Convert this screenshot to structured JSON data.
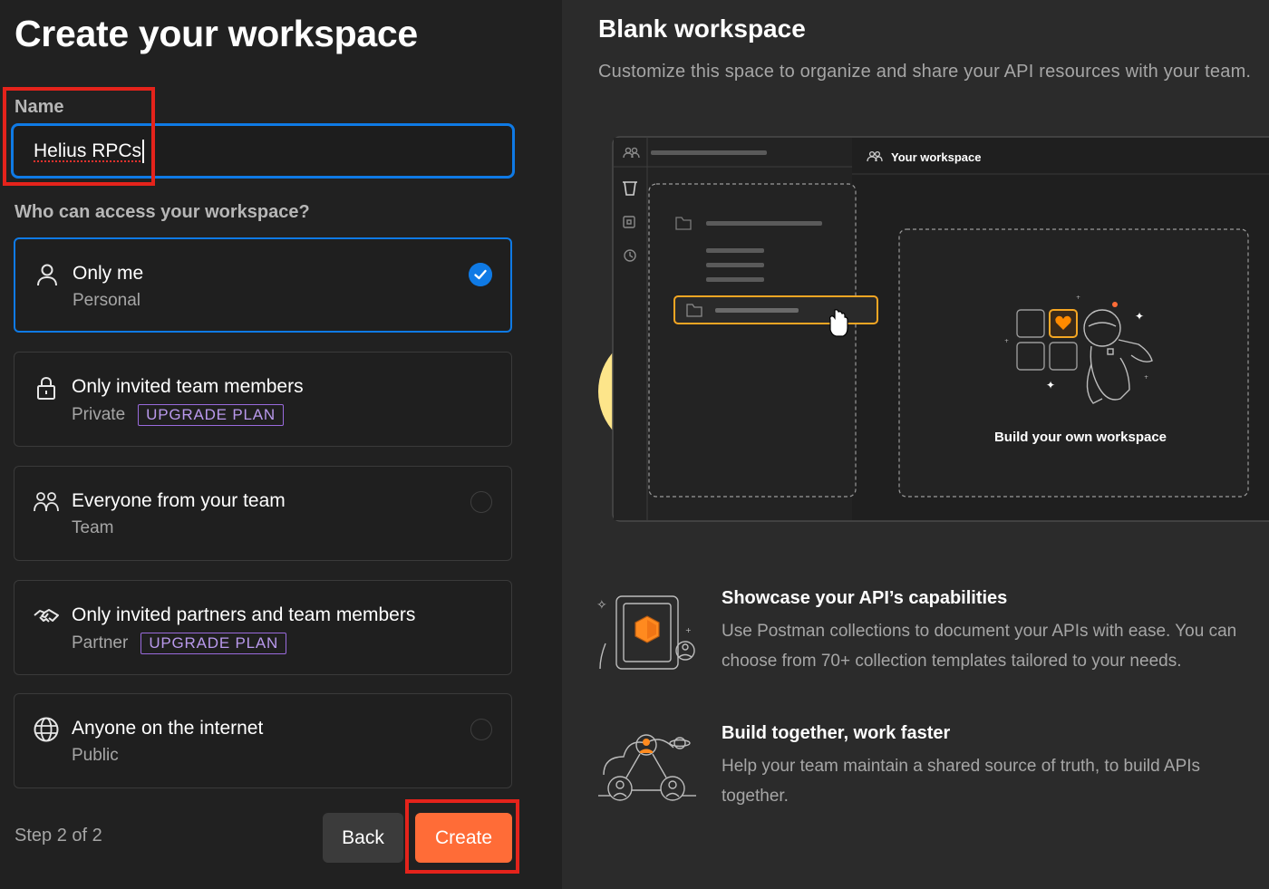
{
  "left": {
    "title": "Create your workspace",
    "name_label": "Name",
    "name_value": "Helius RPCs",
    "access_label": "Who can access your workspace?",
    "options": [
      {
        "title": "Only me",
        "subtitle": "Personal",
        "badge": "",
        "selected": true,
        "icon": "user-icon"
      },
      {
        "title": "Only invited team members",
        "subtitle": "Private",
        "badge": "UPGRADE PLAN",
        "selected": false,
        "icon": "lock-icon"
      },
      {
        "title": "Everyone from your team",
        "subtitle": "Team",
        "badge": "",
        "selected": false,
        "icon": "team-icon"
      },
      {
        "title": "Only invited partners and team members",
        "subtitle": "Partner",
        "badge": "UPGRADE PLAN",
        "selected": false,
        "icon": "handshake-icon"
      },
      {
        "title": "Anyone on the internet",
        "subtitle": "Public",
        "badge": "",
        "selected": false,
        "icon": "globe-icon"
      }
    ],
    "step": "Step 2 of 2",
    "back_label": "Back",
    "create_label": "Create"
  },
  "right": {
    "title": "Blank workspace",
    "subtitle": "Customize this space to organize and share your API resources with your team.",
    "illustration": {
      "tab_label": "Your workspace",
      "card_caption": "Build your own workspace"
    },
    "features": [
      {
        "title": "Showcase your API’s capabilities",
        "line1": "Use Postman collections to document your APIs with ease. You can",
        "line2": "choose from 70+ collection templates tailored to your needs.",
        "icon": "collection-badge-icon"
      },
      {
        "title": "Build together, work faster",
        "line1": "Help your team maintain a shared source of truth, to build APIs",
        "line2": "together.",
        "icon": "team-network-icon"
      }
    ]
  },
  "colors": {
    "accent_blue": "#0f7ae5",
    "accent_orange": "#ff6c37",
    "badge_purple": "#9a6bdd",
    "highlight_red": "#e5231b"
  }
}
